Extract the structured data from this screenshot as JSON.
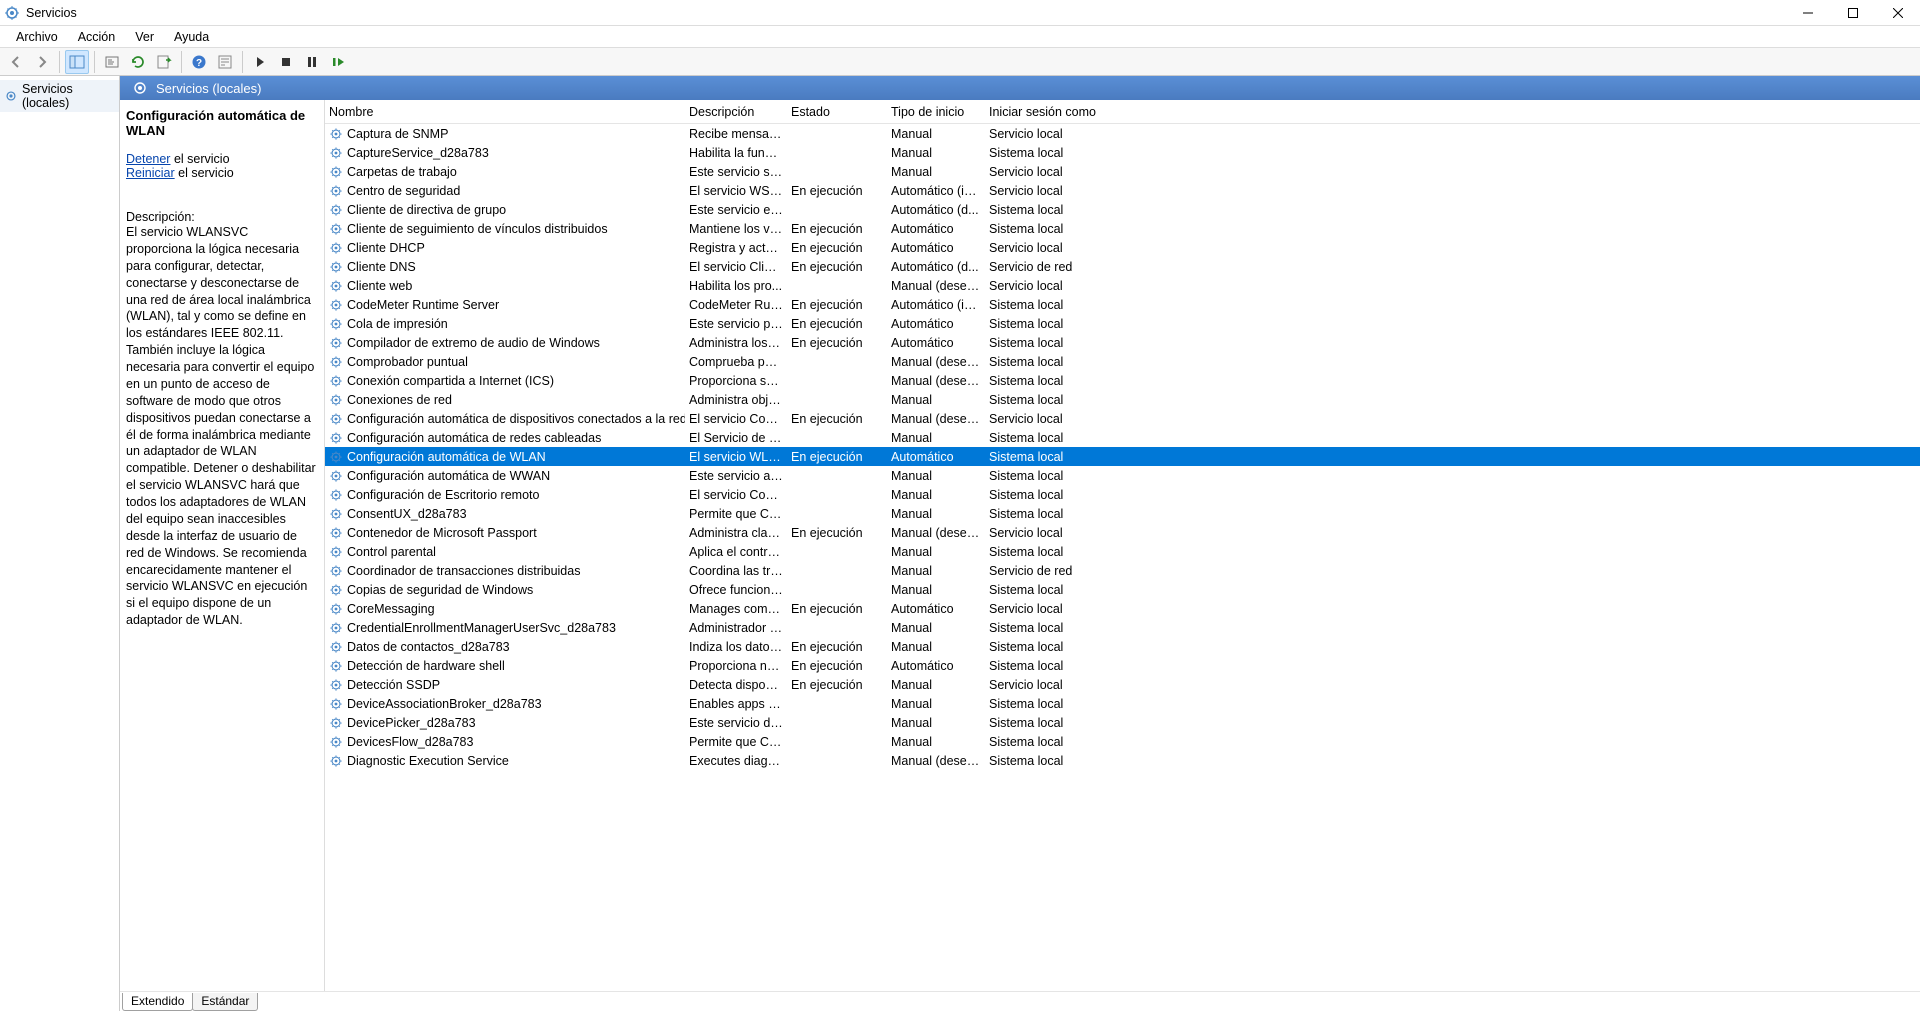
{
  "window": {
    "title": "Servicios"
  },
  "menu": {
    "items": [
      "Archivo",
      "Acción",
      "Ver",
      "Ayuda"
    ]
  },
  "nav": {
    "local_services": "Servicios (locales)"
  },
  "pane_header": {
    "title": "Servicios (locales)"
  },
  "detail": {
    "title": "Configuración automática de WLAN",
    "action_stop_link": "Detener",
    "action_stop_suffix": " el servicio",
    "action_restart_link": "Reiniciar",
    "action_restart_suffix": " el servicio",
    "desc_label": "Descripción:",
    "desc_text": "El servicio WLANSVC proporciona la lógica necesaria para configurar, detectar, conectarse y desconectarse de una red de área local inalámbrica (WLAN), tal y como se define en los estándares IEEE 802.11. También incluye la lógica necesaria para convertir el equipo en un punto de acceso de software de modo que otros dispositivos puedan conectarse a él de forma inalámbrica mediante un adaptador de WLAN compatible. Detener o deshabilitar el servicio WLANSVC hará que todos los adaptadores de WLAN del equipo sean inaccesibles desde la interfaz de usuario de red de Windows. Se recomienda encarecidamente mantener el servicio WLANSVC en ejecución si el equipo dispone de un adaptador de WLAN."
  },
  "columns": {
    "name": "Nombre",
    "desc": "Descripción",
    "state": "Estado",
    "start": "Tipo de inicio",
    "logon": "Iniciar sesión como"
  },
  "tabs": {
    "extended": "Extendido",
    "standard": "Estándar"
  },
  "services": [
    {
      "name": "Captura de SNMP",
      "desc": "Recibe mensaje...",
      "state": "",
      "start": "Manual",
      "logon": "Servicio local",
      "sel": false
    },
    {
      "name": "CaptureService_d28a783",
      "desc": "Habilita la funci...",
      "state": "",
      "start": "Manual",
      "logon": "Sistema local",
      "sel": false
    },
    {
      "name": "Carpetas de trabajo",
      "desc": "Este servicio sin...",
      "state": "",
      "start": "Manual",
      "logon": "Servicio local",
      "sel": false
    },
    {
      "name": "Centro de seguridad",
      "desc": "El servicio WSCS...",
      "state": "En ejecución",
      "start": "Automático (in...",
      "logon": "Servicio local",
      "sel": false
    },
    {
      "name": "Cliente de directiva de grupo",
      "desc": "Este servicio es r...",
      "state": "",
      "start": "Automático (d...",
      "logon": "Sistema local",
      "sel": false
    },
    {
      "name": "Cliente de seguimiento de vínculos distribuidos",
      "desc": "Mantiene los ví...",
      "state": "En ejecución",
      "start": "Automático",
      "logon": "Sistema local",
      "sel": false
    },
    {
      "name": "Cliente DHCP",
      "desc": "Registra y actua...",
      "state": "En ejecución",
      "start": "Automático",
      "logon": "Servicio local",
      "sel": false
    },
    {
      "name": "Cliente DNS",
      "desc": "El servicio Client...",
      "state": "En ejecución",
      "start": "Automático (d...",
      "logon": "Servicio de red",
      "sel": false
    },
    {
      "name": "Cliente web",
      "desc": "Habilita los pro...",
      "state": "",
      "start": "Manual (desen...",
      "logon": "Servicio local",
      "sel": false
    },
    {
      "name": "CodeMeter Runtime Server",
      "desc": "CodeMeter Run...",
      "state": "En ejecución",
      "start": "Automático (in...",
      "logon": "Sistema local",
      "sel": false
    },
    {
      "name": "Cola de impresión",
      "desc": "Este servicio po...",
      "state": "En ejecución",
      "start": "Automático",
      "logon": "Sistema local",
      "sel": false
    },
    {
      "name": "Compilador de extremo de audio de Windows",
      "desc": "Administra los d...",
      "state": "En ejecución",
      "start": "Automático",
      "logon": "Sistema local",
      "sel": false
    },
    {
      "name": "Comprobador puntual",
      "desc": "Comprueba pos...",
      "state": "",
      "start": "Manual (desen...",
      "logon": "Sistema local",
      "sel": false
    },
    {
      "name": "Conexión compartida a Internet (ICS)",
      "desc": "Proporciona ser...",
      "state": "",
      "start": "Manual (desen...",
      "logon": "Sistema local",
      "sel": false
    },
    {
      "name": "Conexiones de red",
      "desc": "Administra obje...",
      "state": "",
      "start": "Manual",
      "logon": "Sistema local",
      "sel": false
    },
    {
      "name": "Configuración automática de dispositivos conectados a la red",
      "desc": "El servicio Confi...",
      "state": "En ejecución",
      "start": "Manual (desen...",
      "logon": "Servicio local",
      "sel": false
    },
    {
      "name": "Configuración automática de redes cableadas",
      "desc": "El Servicio de co...",
      "state": "",
      "start": "Manual",
      "logon": "Sistema local",
      "sel": false
    },
    {
      "name": "Configuración automática de WLAN",
      "desc": "El servicio WLA...",
      "state": "En ejecución",
      "start": "Automático",
      "logon": "Sistema local",
      "sel": true
    },
    {
      "name": "Configuración automática de WWAN",
      "desc": "Este servicio ad...",
      "state": "",
      "start": "Manual",
      "logon": "Sistema local",
      "sel": false
    },
    {
      "name": "Configuración de Escritorio remoto",
      "desc": "El servicio Confi...",
      "state": "",
      "start": "Manual",
      "logon": "Sistema local",
      "sel": false
    },
    {
      "name": "ConsentUX_d28a783",
      "desc": "Permite que Co...",
      "state": "",
      "start": "Manual",
      "logon": "Sistema local",
      "sel": false
    },
    {
      "name": "Contenedor de Microsoft Passport",
      "desc": "Administra clav...",
      "state": "En ejecución",
      "start": "Manual (desen...",
      "logon": "Servicio local",
      "sel": false
    },
    {
      "name": "Control parental",
      "desc": "Aplica el control...",
      "state": "",
      "start": "Manual",
      "logon": "Sistema local",
      "sel": false
    },
    {
      "name": "Coordinador de transacciones distribuidas",
      "desc": "Coordina las tra...",
      "state": "",
      "start": "Manual",
      "logon": "Servicio de red",
      "sel": false
    },
    {
      "name": "Copias de seguridad de Windows",
      "desc": "Ofrece funciona...",
      "state": "",
      "start": "Manual",
      "logon": "Sistema local",
      "sel": false
    },
    {
      "name": "CoreMessaging",
      "desc": "Manages comm...",
      "state": "En ejecución",
      "start": "Automático",
      "logon": "Servicio local",
      "sel": false
    },
    {
      "name": "CredentialEnrollmentManagerUserSvc_d28a783",
      "desc": "Administrador d...",
      "state": "",
      "start": "Manual",
      "logon": "Sistema local",
      "sel": false
    },
    {
      "name": "Datos de contactos_d28a783",
      "desc": "Indiza los datos ...",
      "state": "En ejecución",
      "start": "Manual",
      "logon": "Sistema local",
      "sel": false
    },
    {
      "name": "Detección de hardware shell",
      "desc": "Proporciona not...",
      "state": "En ejecución",
      "start": "Automático",
      "logon": "Sistema local",
      "sel": false
    },
    {
      "name": "Detección SSDP",
      "desc": "Detecta disposit...",
      "state": "En ejecución",
      "start": "Manual",
      "logon": "Servicio local",
      "sel": false
    },
    {
      "name": "DeviceAssociationBroker_d28a783",
      "desc": "Enables apps to...",
      "state": "",
      "start": "Manual",
      "logon": "Sistema local",
      "sel": false
    },
    {
      "name": "DevicePicker_d28a783",
      "desc": "Este servicio de ...",
      "state": "",
      "start": "Manual",
      "logon": "Sistema local",
      "sel": false
    },
    {
      "name": "DevicesFlow_d28a783",
      "desc": "Permite que Co...",
      "state": "",
      "start": "Manual",
      "logon": "Sistema local",
      "sel": false
    },
    {
      "name": "Diagnostic Execution Service",
      "desc": "Executes diagno...",
      "state": "",
      "start": "Manual (desen...",
      "logon": "Sistema local",
      "sel": false
    }
  ]
}
